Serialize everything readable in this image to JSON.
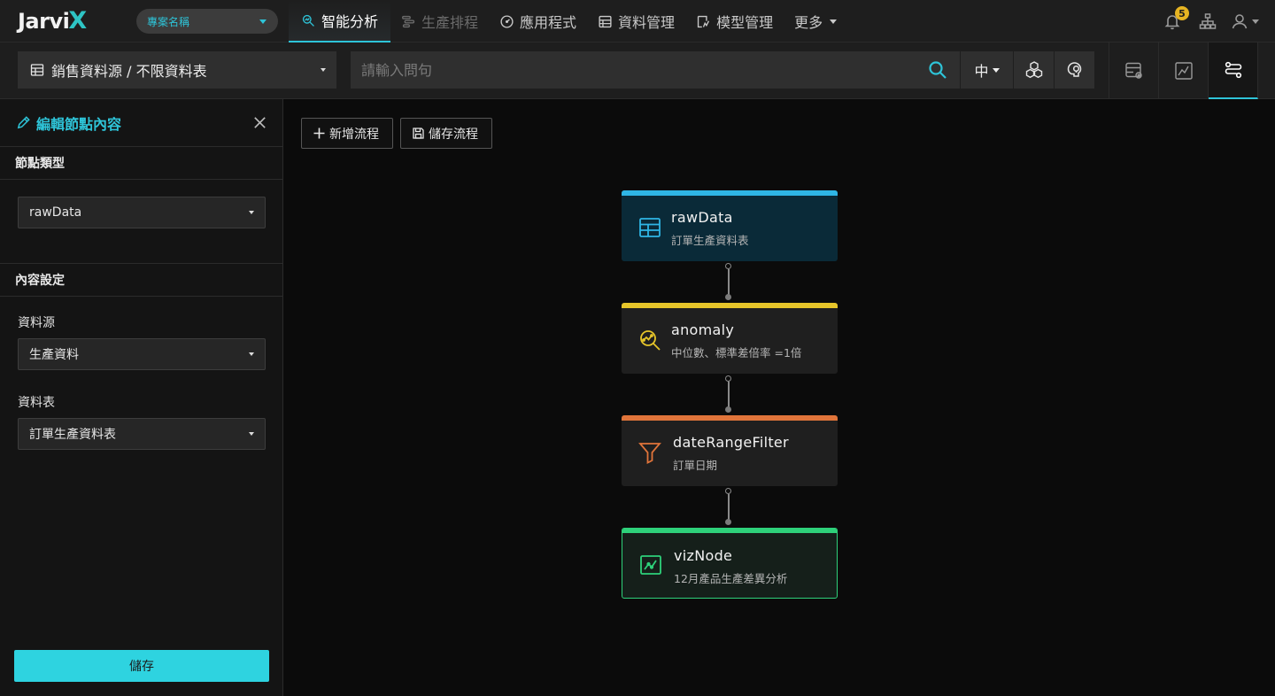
{
  "app": {
    "logo_text": "Jarvi",
    "logo_accent": "X",
    "project_selector": "專案名稱",
    "accent_color": "#2ec4d8"
  },
  "nav": {
    "items": [
      {
        "label": "智能分析",
        "icon": "analysis-icon",
        "state": "active"
      },
      {
        "label": "生產排程",
        "icon": "schedule-icon",
        "state": "disabled"
      },
      {
        "label": "應用程式",
        "icon": "dashboard-gauge-icon",
        "state": "normal"
      },
      {
        "label": "資料管理",
        "icon": "data-table-icon",
        "state": "normal"
      },
      {
        "label": "模型管理",
        "icon": "model-icon",
        "state": "normal"
      },
      {
        "label": "更多",
        "icon": "chevron-down-icon",
        "state": "normal"
      }
    ],
    "notification_count": "5"
  },
  "query": {
    "datasource": "銷售資料源 / 不限資料表",
    "placeholder": "請輸入問句",
    "language": "中"
  },
  "panel": {
    "title": "編輯節點內容",
    "node_type_section": "節點類型",
    "node_type_value": "rawData",
    "content_section": "內容設定",
    "source_label": "資料源",
    "source_value": "生產資料",
    "table_label": "資料表",
    "table_value": "訂單生產資料表",
    "save_label": "儲存"
  },
  "canvas": {
    "add_flow_label": "新增流程",
    "save_flow_label": "儲存流程",
    "nodes": [
      {
        "title": "rawData",
        "subtitle": "訂單生產資料表",
        "color": "#2fb6e6",
        "icon": "table-grid-icon"
      },
      {
        "title": "anomaly",
        "subtitle": "中位數、標準差倍率 =1倍",
        "color": "#e6c52a",
        "icon": "anomaly-search-icon"
      },
      {
        "title": "dateRangeFilter",
        "subtitle": "訂單日期",
        "color": "#e0743a",
        "icon": "filter-funnel-icon"
      },
      {
        "title": "vizNode",
        "subtitle": "12月產品生產差異分析",
        "color": "#2ed17a",
        "icon": "line-chart-icon"
      }
    ]
  }
}
